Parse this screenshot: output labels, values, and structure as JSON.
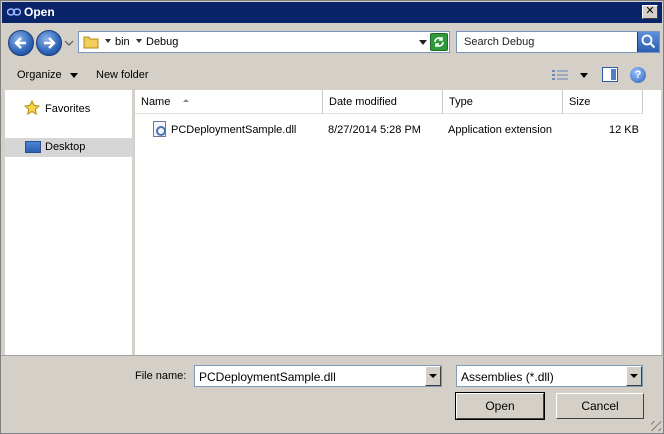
{
  "window": {
    "title": "Open"
  },
  "address": {
    "segments": [
      "bin",
      "Debug"
    ]
  },
  "search": {
    "placeholder": "Search Debug"
  },
  "toolbar": {
    "organize_label": "Organize",
    "new_folder_label": "New folder"
  },
  "nav_pane": {
    "items": [
      {
        "label": "Favorites",
        "icon": "star-icon"
      },
      {
        "label": "Desktop",
        "icon": "desktop-icon"
      }
    ]
  },
  "file_list": {
    "columns": [
      "Name",
      "Date modified",
      "Type",
      "Size"
    ],
    "rows": [
      {
        "name": "PCDeploymentSample.dll",
        "date_modified": "8/27/2014 5:28 PM",
        "type": "Application extension",
        "size": "12 KB"
      }
    ]
  },
  "bottom": {
    "file_name_label": "File name:",
    "file_name_value": "PCDeploymentSample.dll",
    "filter_value": "Assemblies (*.dll)",
    "open_label": "Open",
    "cancel_label": "Cancel"
  },
  "colors": {
    "title_bar": "#0a246a",
    "face": "#d4d0c8",
    "selection": "#d6d6d6"
  }
}
